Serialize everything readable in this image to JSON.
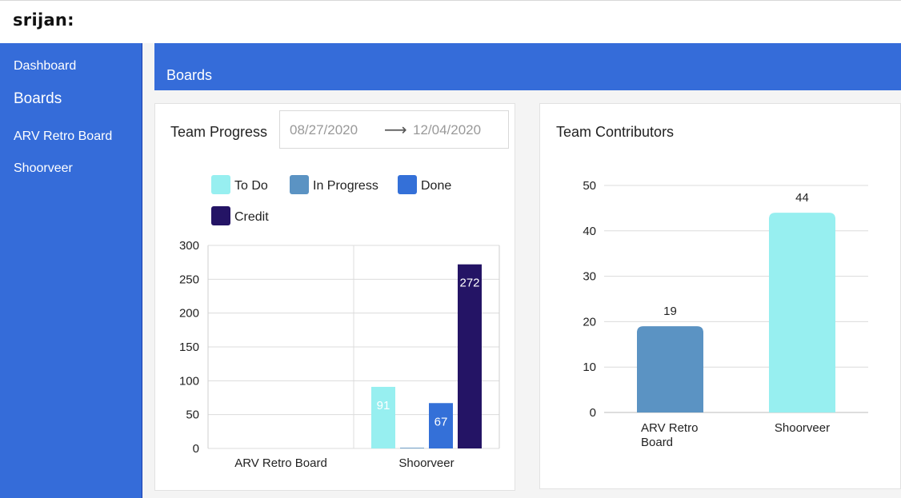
{
  "app": {
    "logo": "srijan:"
  },
  "sidebar": {
    "items": [
      {
        "label": "Dashboard"
      },
      {
        "label": "Boards"
      },
      {
        "label": "ARV Retro Board"
      },
      {
        "label": "Shoorveer"
      }
    ]
  },
  "banner": {
    "title": "Boards"
  },
  "team_progress": {
    "title": "Team Progress",
    "date_start": "08/27/2020",
    "date_end": "12/04/2020"
  },
  "team_contributors": {
    "title": "Team Contributors"
  },
  "icons": {
    "date_range_arrow": "arrow-right-icon",
    "arrow_glyph": "⟶"
  },
  "chart_data": [
    {
      "type": "bar",
      "categories": [
        "ARV Retro Board",
        "Shoorveer"
      ],
      "series": [
        {
          "name": "To Do",
          "color": "#97eff0",
          "values": [
            0,
            91
          ]
        },
        {
          "name": "In Progress",
          "color": "#5b93c3",
          "values": [
            0,
            1
          ]
        },
        {
          "name": "Done",
          "color": "#3470d8",
          "values": [
            0,
            67
          ]
        },
        {
          "name": "Credit",
          "color": "#241465",
          "values": [
            0,
            272
          ]
        }
      ],
      "ylim": [
        0,
        300
      ],
      "yticks": [
        0,
        50,
        100,
        150,
        200,
        250,
        300
      ],
      "data_labels": [
        "91",
        "67",
        "272"
      ],
      "legend": "top"
    },
    {
      "type": "bar",
      "categories": [
        "ARV Retro Board",
        "Shoorveer"
      ],
      "values": [
        19,
        44
      ],
      "colors": [
        "#5b93c3",
        "#97eff0"
      ],
      "ylim": [
        0,
        50
      ],
      "yticks": [
        0,
        10,
        20,
        30,
        40,
        50
      ],
      "legend": "none"
    }
  ]
}
